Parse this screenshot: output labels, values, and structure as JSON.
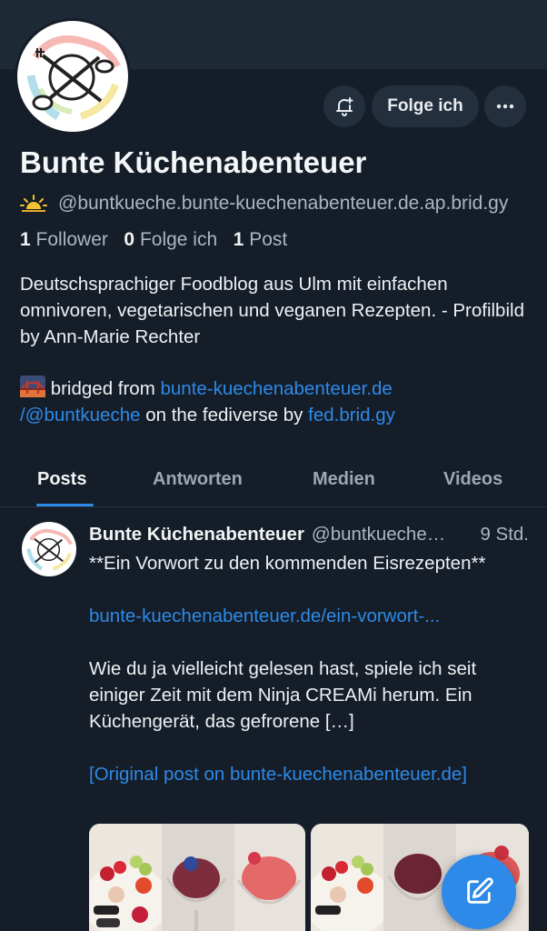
{
  "profile": {
    "display_name": "Bunte Küchenabenteuer",
    "handle": "@buntkueche.bunte-kuechenabenteuer.de.ap.brid.gy",
    "follow_label": "Folge ich",
    "stats": {
      "followers_count": "1",
      "followers_label": "Follower",
      "following_count": "0",
      "following_label": "Folge ich",
      "posts_count": "1",
      "posts_label": "Post"
    },
    "bio": "Deutschsprachiger Foodblog aus Ulm mit einfachen omnivoren, vegetarischen und veganen Rezepten. - Profilbild by Ann-Marie Rechter",
    "bridged": {
      "prefix": "bridged from ",
      "link1a": "bunte-kuechenabenteuer.de",
      "link1b": "/@buntkueche",
      "middle": " on the fediverse by ",
      "link2": "fed.brid.gy"
    }
  },
  "tabs": [
    "Posts",
    "Antworten",
    "Medien",
    "Videos"
  ],
  "post": {
    "author": "Bunte Küchenabenteuer",
    "handle": "@buntkueche.bunte-kuechenabenteuer.de.ap.brid.gy",
    "time": "9 Std.",
    "title": "**Ein Vorwort zu den kommenden Eisrezepten**",
    "link": "bunte-kuechenabenteuer.de/ein-vorwort-...",
    "text": "Wie du ja vielleicht gelesen hast, spiele ich seit einiger Zeit mit dem Ninja CREAMi herum. Ein Küchengerät, das gefrorene […]",
    "original_link": "[Original post on bunte-kuechenabenteuer.de]"
  },
  "colors": {
    "accent": "#2d8ae8",
    "background": "#151d28",
    "banner": "#1e2936"
  },
  "icons": [
    "bell-plus-icon",
    "more-icon",
    "sunrise-icon",
    "bridge-icon",
    "compose-icon"
  ]
}
